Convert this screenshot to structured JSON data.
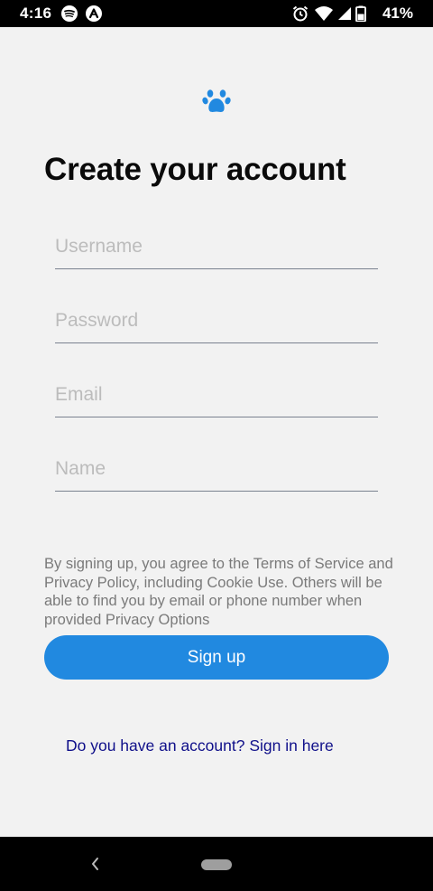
{
  "status_bar": {
    "time": "4:16",
    "battery_percent": "41%",
    "icons": [
      "spotify-icon",
      "arc-app-icon",
      "alarm-icon",
      "wifi-icon",
      "signal-icon",
      "battery-icon"
    ]
  },
  "logo": {
    "icon": "paw-icon",
    "color": "#2189e0"
  },
  "page": {
    "title": "Create your account"
  },
  "form": {
    "username_placeholder": "Username",
    "password_placeholder": "Password",
    "email_placeholder": "Email",
    "name_placeholder": "Name"
  },
  "terms": {
    "text": "By signing up, you agree to the Terms of Service and Privacy Policy, including Cookie Use. Others will be able to find you by email or phone number when provided Privacy Options"
  },
  "signup_button": {
    "label": "Sign up",
    "color": "#2189e0"
  },
  "signin_link": {
    "label": "Do you have an account? Sign in here",
    "color": "#10108a"
  },
  "nav_bar": {
    "back_icon": "back-chevron-icon",
    "home_icon": "home-pill-icon"
  }
}
